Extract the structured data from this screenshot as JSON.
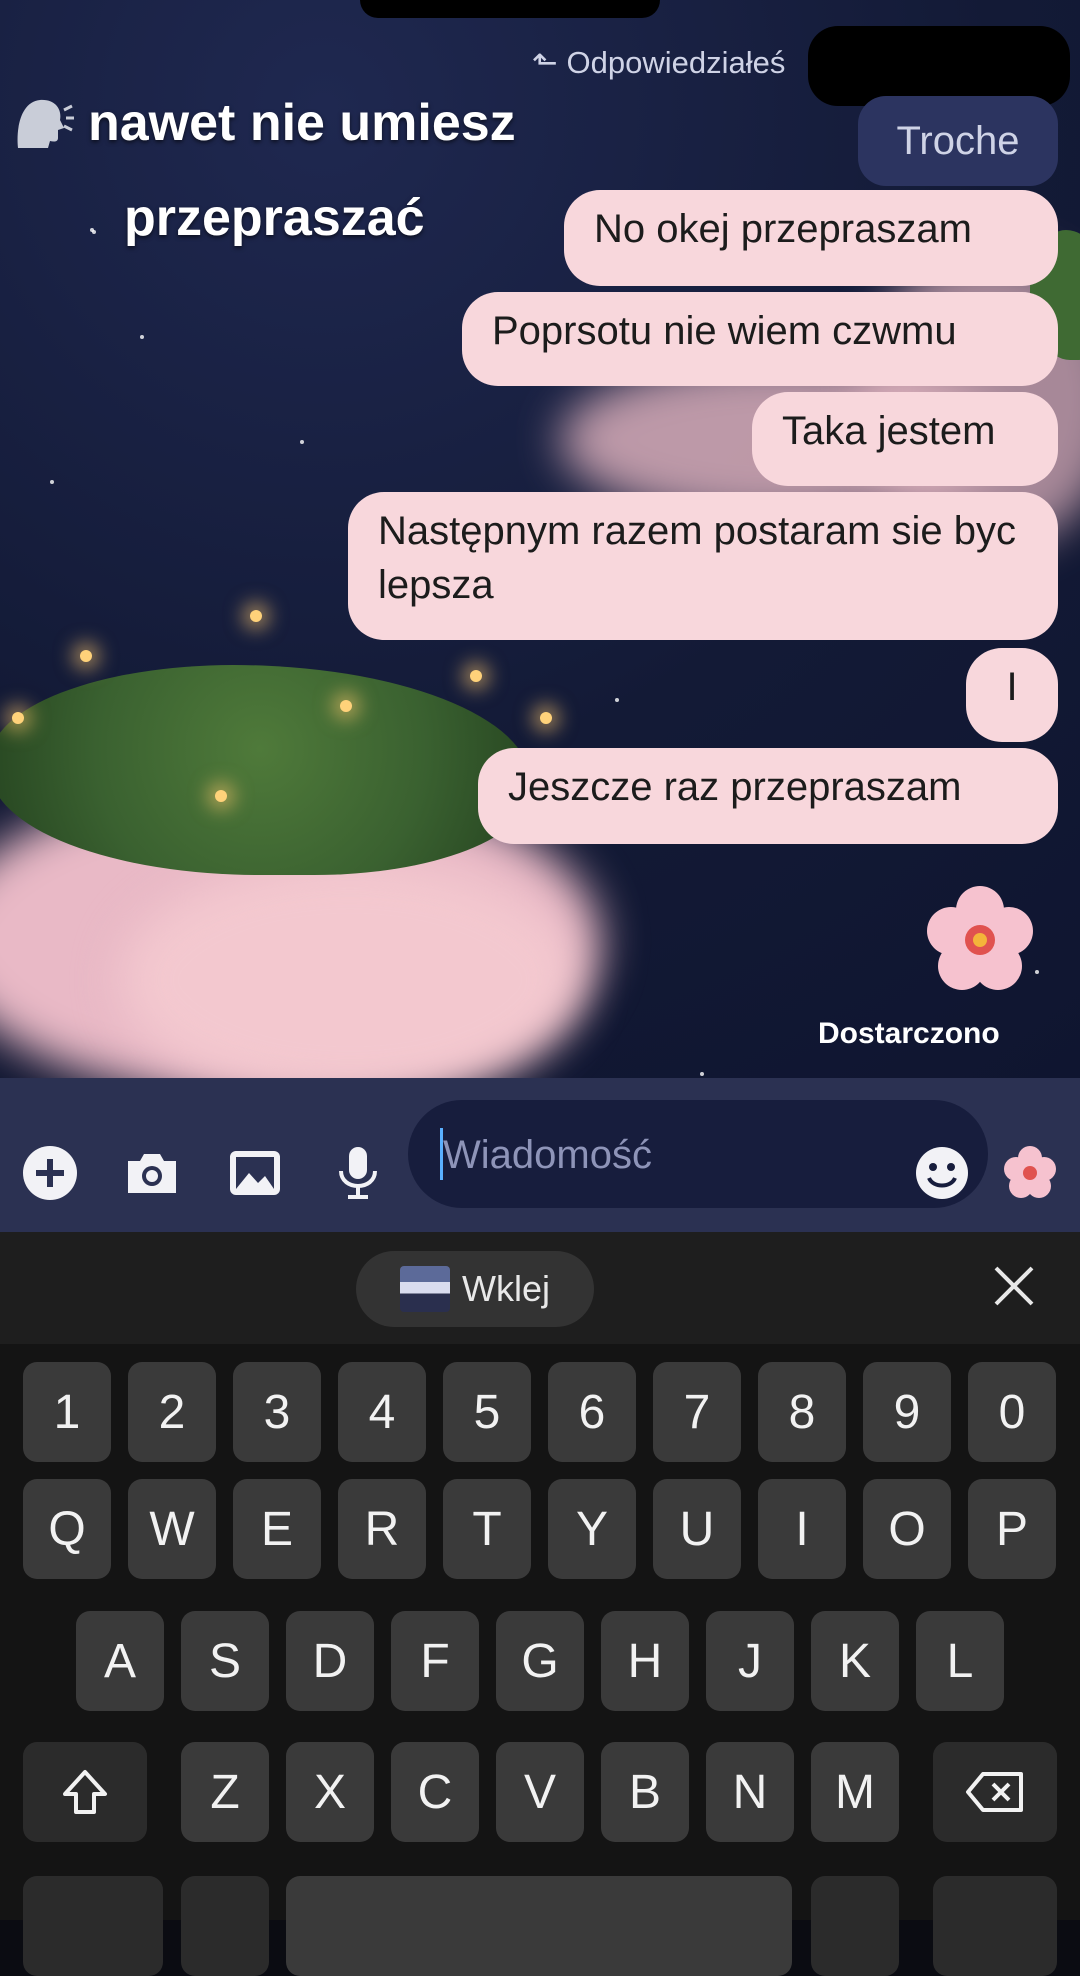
{
  "overlay": {
    "line1": "nawet nie umiesz",
    "line2": "przepraszać"
  },
  "reply": {
    "hint": "Odpowiedziałeś",
    "quoted": "Troche"
  },
  "messages": [
    {
      "text": "No okej przepraszam"
    },
    {
      "text": "Poprsotu nie wiem czwmu"
    },
    {
      "text": "Taka jestem"
    },
    {
      "text": "Następnym razem postaram sie byc lepsza"
    },
    {
      "text": "I"
    },
    {
      "text": "Jeszcze raz przepraszam"
    }
  ],
  "sticker": "cherry-blossom",
  "status": "Dostarczono",
  "composer": {
    "placeholder": "Wiadomość",
    "icons": [
      "plus-circle-icon",
      "camera-icon",
      "gallery-icon",
      "microphone-icon",
      "emoji-icon",
      "flower-icon"
    ]
  },
  "keyboard": {
    "paste_label": "Wklej",
    "number_row": [
      "1",
      "2",
      "3",
      "4",
      "5",
      "6",
      "7",
      "8",
      "9",
      "0"
    ],
    "row1": [
      "Q",
      "W",
      "E",
      "R",
      "T",
      "Y",
      "U",
      "I",
      "O",
      "P"
    ],
    "row2": [
      "A",
      "S",
      "D",
      "F",
      "G",
      "H",
      "J",
      "K",
      "L"
    ],
    "row3": [
      "Z",
      "X",
      "C",
      "V",
      "B",
      "N",
      "M"
    ]
  },
  "colors": {
    "bubble": "#f8d7dc",
    "chat_bg": "#131a36",
    "input_bar": "#2b3152",
    "keyboard_bg": "#141414",
    "key": "#3a3a3a"
  }
}
